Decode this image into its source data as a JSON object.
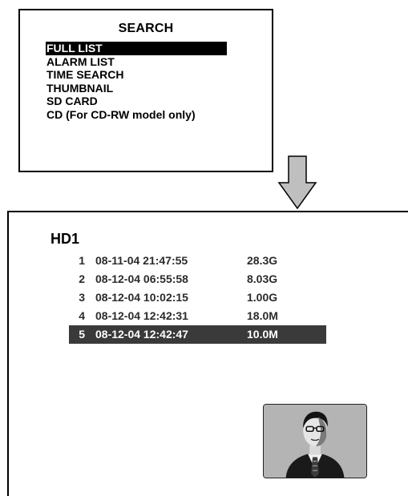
{
  "search_menu": {
    "title": "SEARCH",
    "items": [
      {
        "label": "FULL LIST",
        "selected": true
      },
      {
        "label": "ALARM LIST",
        "selected": false
      },
      {
        "label": "TIME SEARCH",
        "selected": false
      },
      {
        "label": "THUMBNAIL",
        "selected": false
      },
      {
        "label": "SD CARD",
        "selected": false
      },
      {
        "label": "CD (For CD-RW model only)",
        "selected": false
      }
    ]
  },
  "hd_list": {
    "title": "HD1",
    "records": [
      {
        "num": "1",
        "datetime": "08-11-04 21:47:55",
        "size": "28.3G",
        "selected": false
      },
      {
        "num": "2",
        "datetime": "08-12-04 06:55:58",
        "size": "8.03G",
        "selected": false
      },
      {
        "num": "3",
        "datetime": "08-12-04 10:02:15",
        "size": "1.00G",
        "selected": false
      },
      {
        "num": "4",
        "datetime": "08-12-04 12:42:31",
        "size": "18.0M",
        "selected": false
      },
      {
        "num": "5",
        "datetime": "08-12-04 12:42:47",
        "size": "10.0M",
        "selected": true
      }
    ]
  },
  "icons": {
    "arrow": "down-arrow-icon",
    "thumbnail": "person-thumbnail-icon"
  },
  "colors": {
    "highlight_menu": "#000000",
    "highlight_row": "#3a3a3a",
    "arrow_fill": "#bfbfbf",
    "thumbnail_bg": "#b4b4b4"
  }
}
